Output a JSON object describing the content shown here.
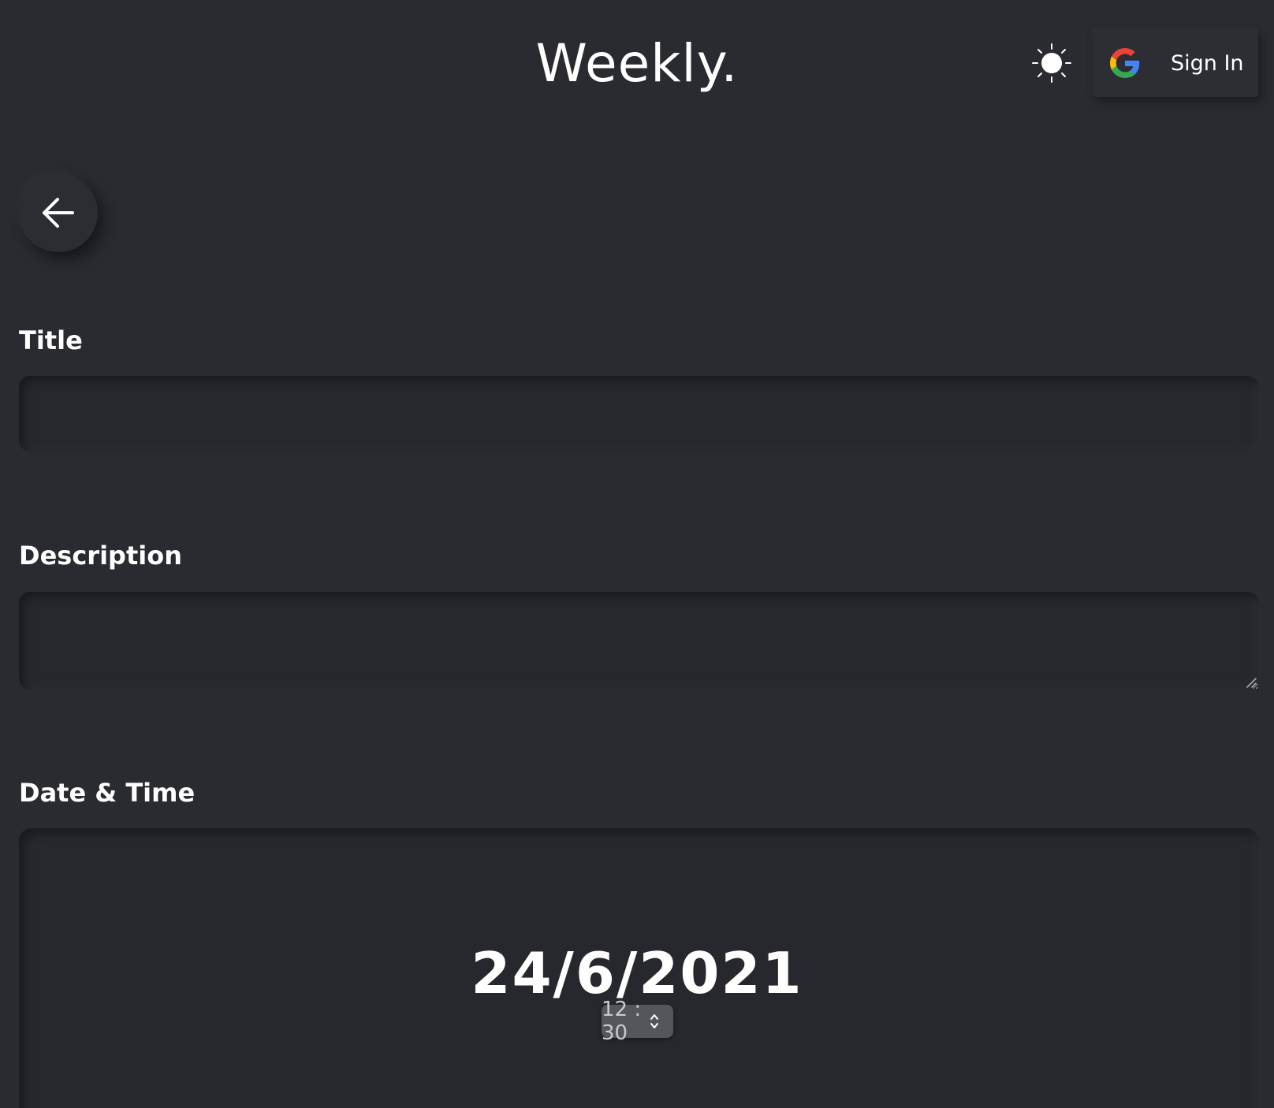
{
  "header": {
    "app_title": "Weekly.",
    "theme_icon": "sun-icon",
    "signin_label": "Sign In",
    "signin_icon": "google-icon"
  },
  "navigation": {
    "back_icon": "arrow-left-icon"
  },
  "form": {
    "title_label": "Title",
    "title_value": "",
    "description_label": "Description",
    "description_value": "",
    "datetime_label": "Date & Time",
    "date_value": "24/6/2021",
    "time_value": "12 : 30"
  },
  "colors": {
    "background": "#2a2b30",
    "text": "#ffffff",
    "google_blue": "#4285F4",
    "google_red": "#EA4335",
    "google_yellow": "#FBBC05",
    "google_green": "#34A853"
  }
}
